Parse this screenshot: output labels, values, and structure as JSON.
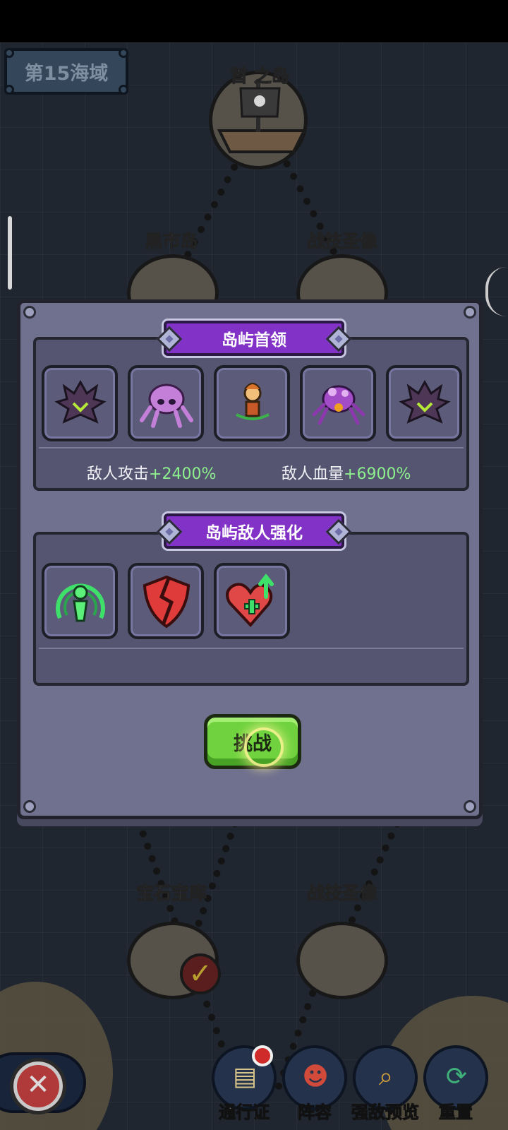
{
  "map": {
    "region_label": "第15海域",
    "islands": [
      {
        "name": "首领之岛",
        "label": "首 之岛"
      },
      {
        "name": "黑市岛",
        "label": "黑市岛"
      },
      {
        "name": "战技圣像-top",
        "label": "战技圣像"
      },
      {
        "name": "宝石宝库",
        "label": "宝石宝库"
      },
      {
        "name": "战技圣像-bottom",
        "label": "战技圣像"
      }
    ]
  },
  "modal": {
    "boss_section": {
      "title": "岛屿首领",
      "bosses": [
        {
          "icon": "dark-spiky-beetle-icon",
          "color": "#5b3a66"
        },
        {
          "icon": "purple-squid-icon",
          "color": "#c47fd9"
        },
        {
          "icon": "orange-archer-hero-icon",
          "color": "#e79a3c"
        },
        {
          "icon": "purple-spider-queen-icon",
          "color": "#a24cc8"
        },
        {
          "icon": "dark-spiky-beetle-icon",
          "color": "#5b3a66"
        }
      ],
      "stats": [
        {
          "label": "敌人攻击",
          "value": "+2400%"
        },
        {
          "label": "敌人血量",
          "value": "+6900%"
        }
      ]
    },
    "buff_section": {
      "title": "岛屿敌人强化",
      "buffs": [
        {
          "icon": "green-aura-figure-icon",
          "color": "#3ee06a"
        },
        {
          "icon": "broken-shield-icon",
          "color": "#e03b3b"
        },
        {
          "icon": "heart-heal-up-icon",
          "color": "#e04747"
        }
      ]
    },
    "challenge_label": "挑战"
  },
  "bottom_bar": {
    "close_label": "✕",
    "buttons": [
      {
        "label": "通行证",
        "icon": "passport-icon"
      },
      {
        "label": "阵容",
        "icon": "lineup-icon"
      },
      {
        "label": "强敌预览",
        "icon": "magnifier-icon"
      },
      {
        "label": "重置",
        "icon": "reset-icon"
      }
    ]
  }
}
